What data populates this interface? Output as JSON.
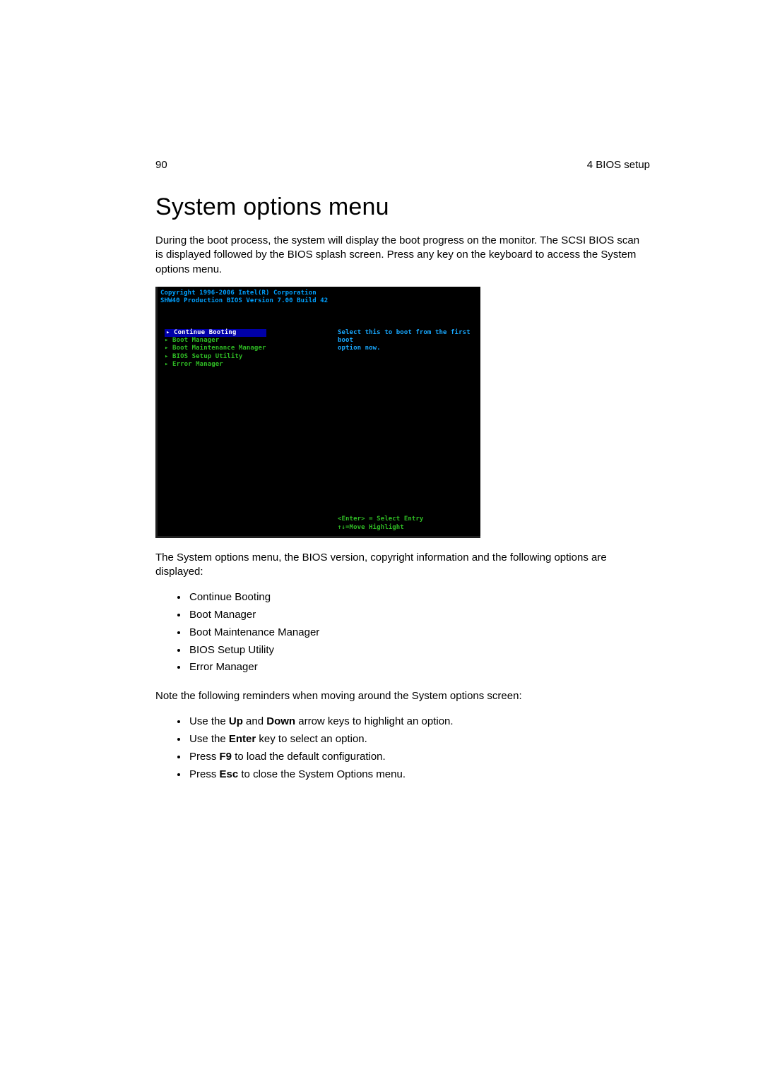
{
  "header": {
    "page_number": "90",
    "section": "4 BIOS setup"
  },
  "title": "System options menu",
  "para1": "During the boot process, the system will display the boot progress on the monitor. The SCSI BIOS scan is displayed followed by the BIOS splash screen. Press any key on the keyboard to access the System options menu.",
  "bios": {
    "copyright": "Copyright 1996-2006 Intel(R) Corporation",
    "version": "SHW40 Production BIOS Version 7.00 Build 42",
    "items": {
      "i0": "Continue Booting",
      "i1": "Boot Manager",
      "i2": "Boot Maintenance Manager",
      "i3": "BIOS Setup Utility",
      "i4": "Error Manager"
    },
    "help1": "Select this to boot from the first boot",
    "help2": "option now.",
    "foot1": "<Enter> = Select Entry",
    "foot2": "↑↓=Move Highlight"
  },
  "para2": "The System options menu, the BIOS version, copyright information and the following options are displayed:",
  "list1": {
    "a": "Continue Booting",
    "b": "Boot Manager",
    "c": "Boot Maintenance Manager",
    "d": "BIOS Setup Utility",
    "e": "Error Manager"
  },
  "para3": "Note the following reminders when moving around the System options screen:",
  "list2": {
    "a_pre": "Use the ",
    "a_b1": "Up",
    "a_mid": " and ",
    "a_b2": "Down",
    "a_post": " arrow keys to highlight an option.",
    "b_pre": "Use the ",
    "b_b": "Enter",
    "b_post": " key to select an option.",
    "c_pre": "Press ",
    "c_b": "F9",
    "c_post": " to load the default configuration.",
    "d_pre": "Press ",
    "d_b": "Esc",
    "d_post": " to close the System Options menu."
  }
}
